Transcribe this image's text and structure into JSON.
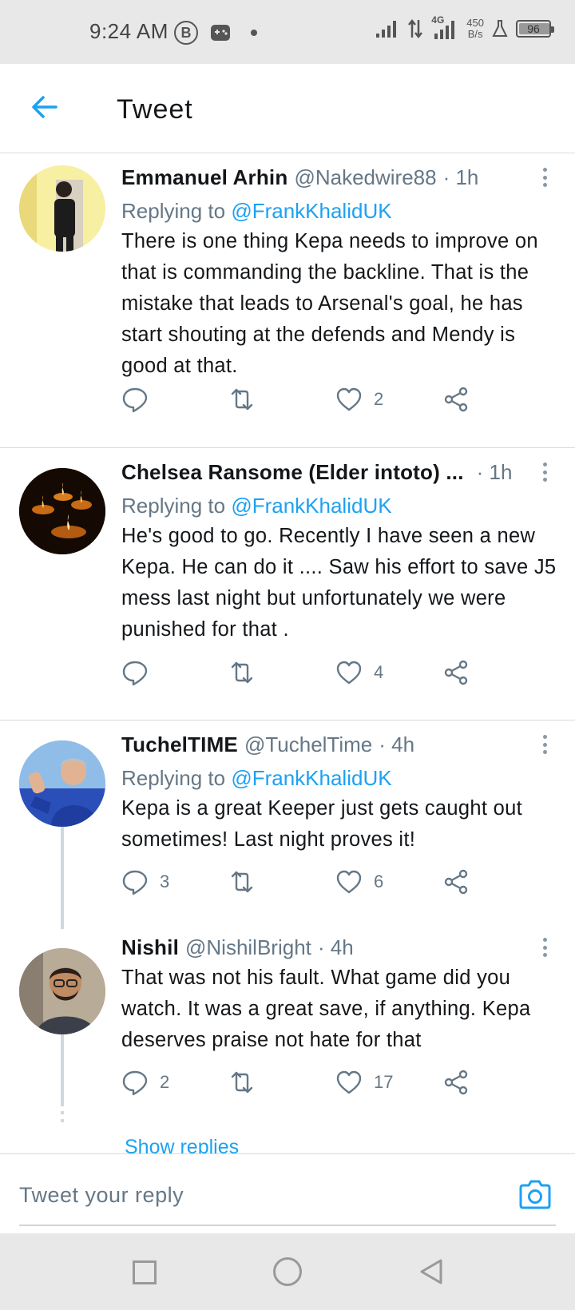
{
  "status_bar": {
    "time": "9:24 AM",
    "b_icon_letter": "B",
    "network_type": "4G",
    "net_speed_value": "450",
    "net_speed_unit": "B/s",
    "battery": "96"
  },
  "header": {
    "title": "Tweet"
  },
  "tweets": [
    {
      "name": "Emmanuel Arhin",
      "handle": "@Nakedwire88",
      "time": "· 1h",
      "replying_prefix": "Replying to",
      "replying_to": "@FrankKhalidUK",
      "text": "There is one thing Kepa needs to improve on that is commanding the backline. That is the mistake that leads to Arsenal's goal, he has start shouting at the defends and Mendy is good at that.",
      "reply_count": "",
      "retweet_count": "",
      "like_count": "2"
    },
    {
      "name": "Chelsea Ransome (Elder intoto) ...",
      "handle": "",
      "time": "· 1h",
      "replying_prefix": "Replying to",
      "replying_to": "@FrankKhalidUK",
      "text": "He's good to go. Recently I have seen a new Kepa. He can do it .... Saw his effort to save J5 mess last night but unfortunately we were punished for that .",
      "reply_count": "",
      "retweet_count": "",
      "like_count": "4"
    },
    {
      "name": "TuchelTIME",
      "handle": "@TuchelTime",
      "time": "· 4h",
      "replying_prefix": "Replying to",
      "replying_to": "@FrankKhalidUK",
      "text": "Kepa is a great Keeper just gets caught out sometimes! Last night proves it!",
      "reply_count": "3",
      "retweet_count": "",
      "like_count": "6"
    },
    {
      "name": "Nishil",
      "handle": "@NishilBright",
      "time": "· 4h",
      "text": "That was not his fault. What game did you watch. It was a great save, if anything. Kepa deserves praise not hate for that",
      "reply_count": "2",
      "retweet_count": "",
      "like_count": "17"
    }
  ],
  "show_replies": "Show replies",
  "reply_bar": {
    "placeholder": "Tweet your reply"
  },
  "colors": {
    "accent": "#1da1f2",
    "secondary_text": "#657786",
    "primary_text": "#14171a",
    "divider": "#d6dbdf"
  }
}
